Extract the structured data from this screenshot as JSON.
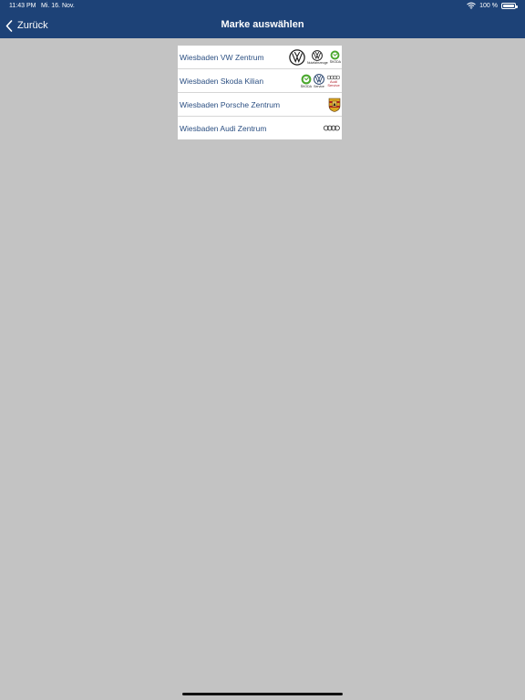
{
  "status_bar": {
    "time": "11:43 PM",
    "date": "Mi. 16. Nov.",
    "battery": "100 %",
    "icons": [
      "wifi-icon",
      "battery-icon"
    ]
  },
  "nav": {
    "back_label": "Zurück",
    "title": "Marke auswählen",
    "back_icon": "chevron-left-icon"
  },
  "dealers": [
    {
      "label": "Wiesbaden VW Zentrum",
      "logos": [
        "vw-logo",
        "vw-nutzfahrzeuge-logo",
        "skoda-logo"
      ],
      "captions": [
        "Nutzfahrzeuge",
        "ŠKODA"
      ]
    },
    {
      "label": "Wiesbaden Skoda Kilian",
      "logos": [
        "skoda-logo",
        "vw-service-logo",
        "audi-service-logo"
      ],
      "captions": [
        "ŠKODA",
        "Service",
        "Audi",
        "Service"
      ]
    },
    {
      "label": "Wiesbaden Porsche Zentrum",
      "logos": [
        "porsche-crest-logo"
      ]
    },
    {
      "label": "Wiesbaden Audi Zentrum",
      "logos": [
        "audi-rings-logo"
      ]
    }
  ],
  "colors": {
    "header": "#1d4277",
    "background": "#c3c3c3",
    "row_text": "#2b4f82",
    "skoda_green": "#4ba82e",
    "audi_red": "#b1202a"
  }
}
